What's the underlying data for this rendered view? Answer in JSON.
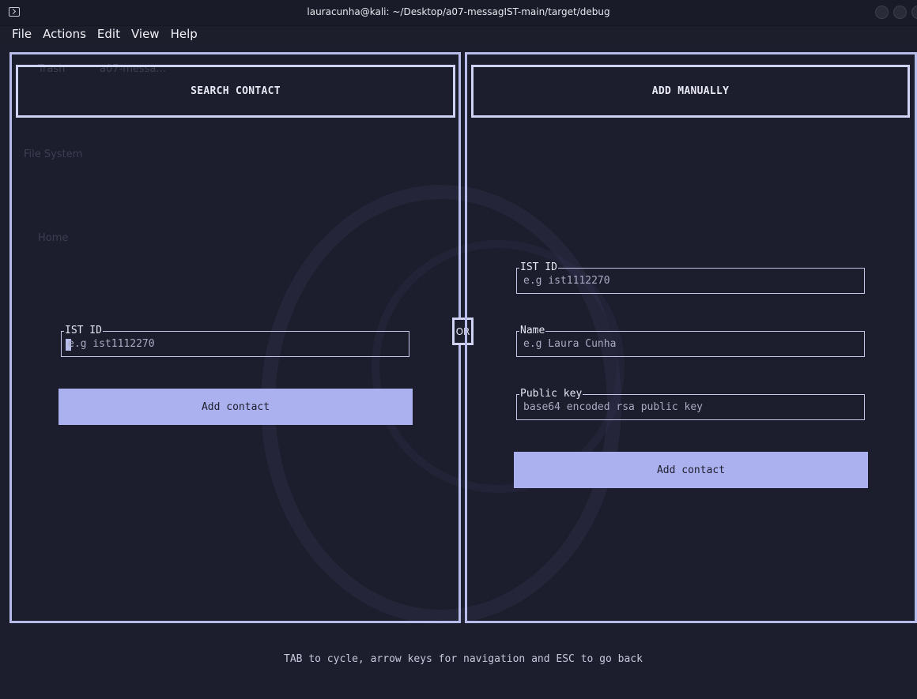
{
  "window": {
    "title": "lauracunha@kali: ~/Desktop/a07-messagIST-main/target/debug"
  },
  "menu": {
    "items": [
      "File",
      "Actions",
      "Edit",
      "View",
      "Help"
    ]
  },
  "desktop_ghost": {
    "trash": "Trash",
    "folder": "a07-messa...",
    "filesystem": "File System",
    "home": "Home"
  },
  "left_panel": {
    "header": "SEARCH CONTACT",
    "ist_id": {
      "label": "IST ID",
      "placeholder": "e.g ist1112270",
      "value": ""
    },
    "button": "Add contact"
  },
  "separator": "OR",
  "right_panel": {
    "header": "ADD MANUALLY",
    "ist_id": {
      "label": "IST ID",
      "placeholder": "e.g ist1112270",
      "value": ""
    },
    "name": {
      "label": "Name",
      "placeholder": "e.g Laura Cunha",
      "value": ""
    },
    "public_key": {
      "label": "Public key",
      "placeholder": "base64 encoded rsa public key",
      "value": ""
    },
    "button": "Add contact"
  },
  "footer": {
    "hint": "TAB to cycle, arrow keys for navigation and ESC to go back"
  },
  "colors": {
    "background": "#1d1e2d",
    "panel_border": "#b8bcea",
    "button_bg": "#abb0ef",
    "text": "#e6e7f3",
    "placeholder": "#a9abc2"
  }
}
